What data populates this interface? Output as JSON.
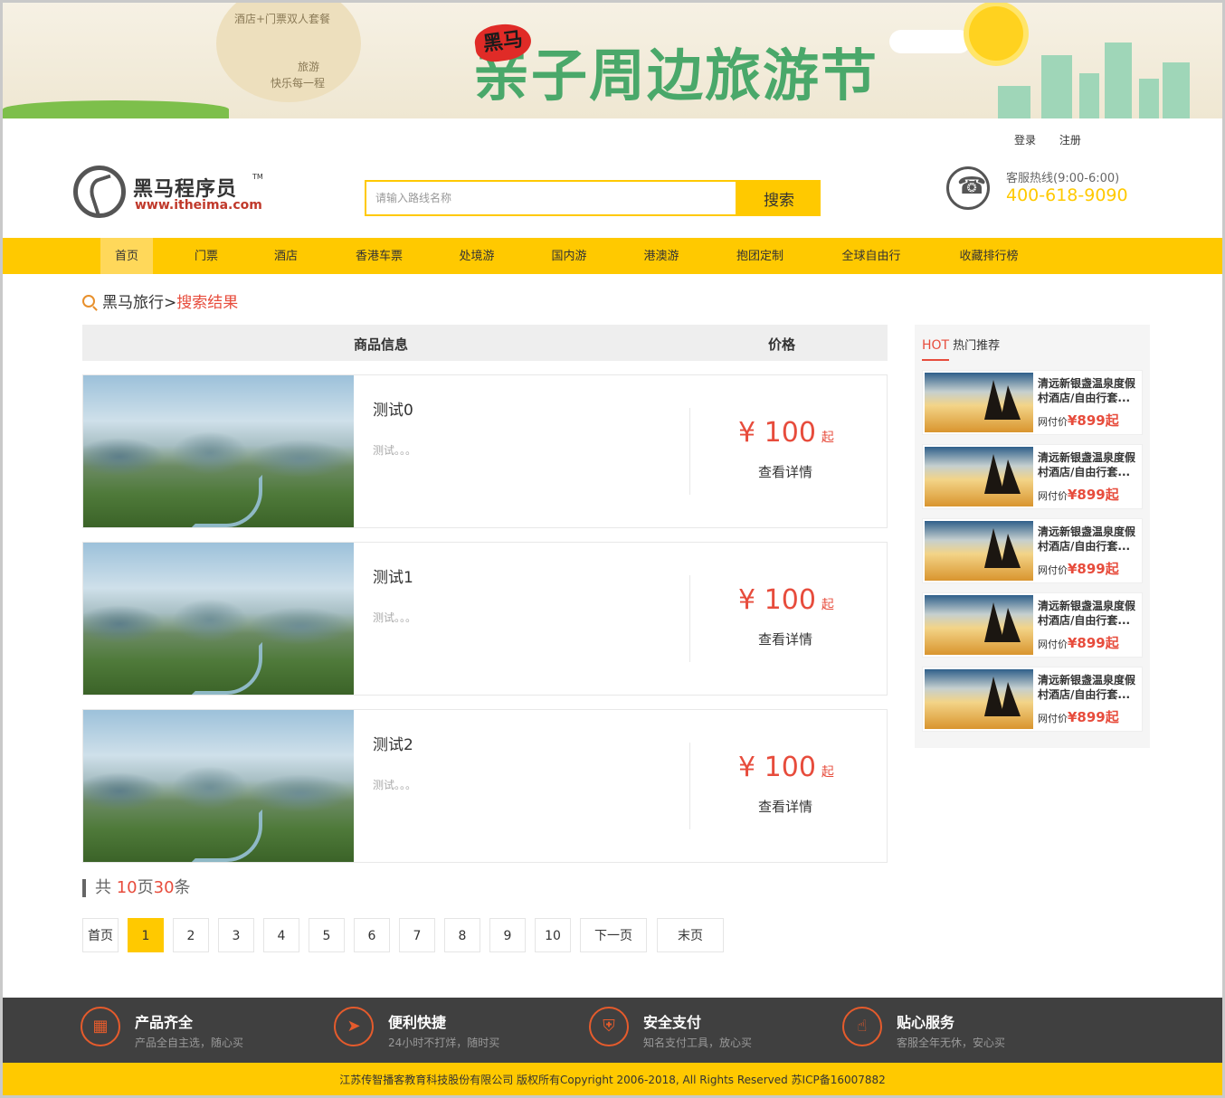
{
  "banner": {
    "package_line1": "酒店+门票双人套餐",
    "package_line2": "旅游",
    "package_line3": "快乐每一程",
    "badge": "黑马",
    "slogan": "亲子周边旅游节"
  },
  "toplinks": {
    "login": "登录",
    "register": "注册"
  },
  "logo": {
    "name_cn": "黑马程序员",
    "tm": "TM",
    "url": "www.itheima.com"
  },
  "search": {
    "placeholder": "请输入路线名称",
    "button": "搜索"
  },
  "hotline": {
    "label": "客服热线(9:00-6:00)",
    "number": "400-618-9090"
  },
  "nav": [
    {
      "label": "首页",
      "active": true
    },
    {
      "label": "门票"
    },
    {
      "label": "酒店"
    },
    {
      "label": "香港车票"
    },
    {
      "label": "处境游"
    },
    {
      "label": "国内游"
    },
    {
      "label": "港澳游"
    },
    {
      "label": "抱团定制"
    },
    {
      "label": "全球自由行"
    },
    {
      "label": "收藏排行榜"
    }
  ],
  "breadcrumb": {
    "home": "黑马旅行",
    "sep": ">",
    "current": "搜索结果"
  },
  "table": {
    "col_info": "商品信息",
    "col_price": "价格"
  },
  "results": [
    {
      "title": "测试0",
      "desc": "测试。。。",
      "currency": "¥",
      "price": "100",
      "suffix": "起",
      "detail": "查看详情"
    },
    {
      "title": "测试1",
      "desc": "测试。。。",
      "currency": "¥",
      "price": "100",
      "suffix": "起",
      "detail": "查看详情"
    },
    {
      "title": "测试2",
      "desc": "测试。。。",
      "currency": "¥",
      "price": "100",
      "suffix": "起",
      "detail": "查看详情"
    }
  ],
  "summary": {
    "prefix": "共 ",
    "pages": "10",
    "mid": "页",
    "count": "30",
    "suffix": "条"
  },
  "pagination": {
    "first": "首页",
    "pages": [
      "1",
      "2",
      "3",
      "4",
      "5",
      "6",
      "7",
      "8",
      "9",
      "10"
    ],
    "current": "1",
    "next": "下一页",
    "last": "末页"
  },
  "hot": {
    "tag": "HOT",
    "title": "热门推荐",
    "items": [
      {
        "name": "清远新银盏温泉度假村酒店/自由行套...",
        "price_label": "网付价",
        "price": "¥899起"
      },
      {
        "name": "清远新银盏温泉度假村酒店/自由行套...",
        "price_label": "网付价",
        "price": "¥899起"
      },
      {
        "name": "清远新银盏温泉度假村酒店/自由行套...",
        "price_label": "网付价",
        "price": "¥899起"
      },
      {
        "name": "清远新银盏温泉度假村酒店/自由行套...",
        "price_label": "网付价",
        "price": "¥899起"
      },
      {
        "name": "清远新银盏温泉度假村酒店/自由行套...",
        "price_label": "网付价",
        "price": "¥899起"
      }
    ]
  },
  "features": [
    {
      "icon": "grid-icon",
      "name": "产品齐全",
      "desc": "产品全自主选，随心买"
    },
    {
      "icon": "rocket-icon",
      "name": "便利快捷",
      "desc": "24小时不打烊，随时买"
    },
    {
      "icon": "shield-icon",
      "name": "安全支付",
      "desc": "知名支付工具，放心买"
    },
    {
      "icon": "thumbs-up-icon",
      "name": "贴心服务",
      "desc": "客服全年无休，安心买"
    }
  ],
  "copyright": "江苏传智播客教育科技股份有限公司 版权所有Copyright 2006-2018, All Rights Reserved 苏ICP备16007882",
  "colors": {
    "brand_yellow": "#ffc900",
    "accent_red": "#e74c3c",
    "footer_dark": "#404040"
  }
}
